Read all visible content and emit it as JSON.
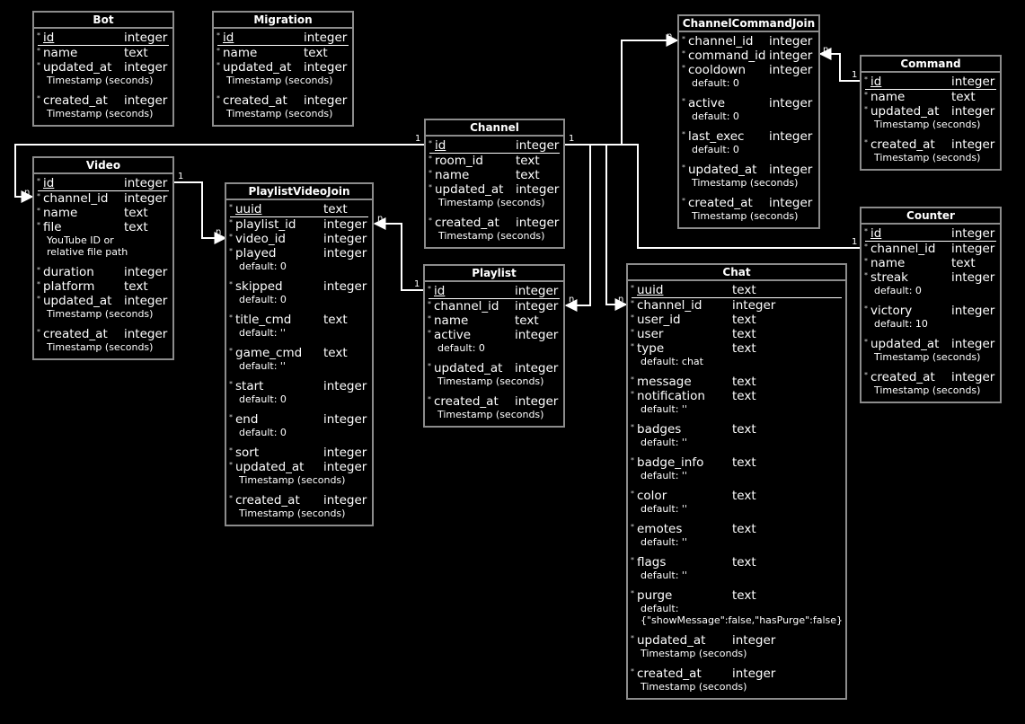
{
  "tables": {
    "Bot": {
      "title": "Bot",
      "fields": [
        {
          "name": "id",
          "type": "integer",
          "pk": true
        },
        {
          "name": "name",
          "type": "text"
        },
        {
          "name": "updated_at",
          "type": "integer",
          "notes": [
            "Timestamp (seconds)"
          ]
        },
        {
          "name": "created_at",
          "type": "integer",
          "notes": [
            "Timestamp (seconds)"
          ]
        }
      ]
    },
    "Migration": {
      "title": "Migration",
      "fields": [
        {
          "name": "id",
          "type": "integer",
          "pk": true
        },
        {
          "name": "name",
          "type": "text"
        },
        {
          "name": "updated_at",
          "type": "integer",
          "notes": [
            "Timestamp (seconds)"
          ]
        },
        {
          "name": "created_at",
          "type": "integer",
          "notes": [
            "Timestamp (seconds)"
          ]
        }
      ]
    },
    "Video": {
      "title": "Video",
      "fields": [
        {
          "name": "id",
          "type": "integer",
          "pk": true
        },
        {
          "name": "channel_id",
          "type": "integer"
        },
        {
          "name": "name",
          "type": "text"
        },
        {
          "name": "file",
          "type": "text",
          "notes": [
            "YouTube ID or",
            "relative file path"
          ]
        },
        {
          "name": "duration",
          "type": "integer"
        },
        {
          "name": "platform",
          "type": "text"
        },
        {
          "name": "updated_at",
          "type": "integer",
          "notes": [
            "Timestamp (seconds)"
          ]
        },
        {
          "name": "created_at",
          "type": "integer",
          "notes": [
            "Timestamp (seconds)"
          ]
        }
      ]
    },
    "PlaylistVideoJoin": {
      "title": "PlaylistVideoJoin",
      "fields": [
        {
          "name": "uuid",
          "type": "text",
          "pk": true
        },
        {
          "name": "playlist_id",
          "type": "integer"
        },
        {
          "name": "video_id",
          "type": "integer"
        },
        {
          "name": "played",
          "type": "integer",
          "notes": [
            "default: 0"
          ]
        },
        {
          "name": "skipped",
          "type": "integer",
          "notes": [
            "default: 0"
          ]
        },
        {
          "name": "title_cmd",
          "type": "text",
          "notes": [
            "default: ''"
          ]
        },
        {
          "name": "game_cmd",
          "type": "text",
          "notes": [
            "default: ''"
          ]
        },
        {
          "name": "start",
          "type": "integer",
          "notes": [
            "default: 0"
          ]
        },
        {
          "name": "end",
          "type": "integer",
          "notes": [
            "default: 0"
          ]
        },
        {
          "name": "sort",
          "type": "integer"
        },
        {
          "name": "updated_at",
          "type": "integer",
          "notes": [
            "Timestamp (seconds)"
          ]
        },
        {
          "name": "created_at",
          "type": "integer",
          "notes": [
            "Timestamp (seconds)"
          ]
        }
      ]
    },
    "Channel": {
      "title": "Channel",
      "fields": [
        {
          "name": "id",
          "type": "integer",
          "pk": true
        },
        {
          "name": "room_id",
          "type": "text"
        },
        {
          "name": "name",
          "type": "text"
        },
        {
          "name": "updated_at",
          "type": "integer",
          "notes": [
            "Timestamp (seconds)"
          ]
        },
        {
          "name": "created_at",
          "type": "integer",
          "notes": [
            "Timestamp (seconds)"
          ]
        }
      ]
    },
    "Playlist": {
      "title": "Playlist",
      "fields": [
        {
          "name": "id",
          "type": "integer",
          "pk": true
        },
        {
          "name": "channel_id",
          "type": "integer"
        },
        {
          "name": "name",
          "type": "text"
        },
        {
          "name": "active",
          "type": "integer",
          "notes": [
            "default: 0"
          ]
        },
        {
          "name": "updated_at",
          "type": "integer",
          "notes": [
            "Timestamp (seconds)"
          ]
        },
        {
          "name": "created_at",
          "type": "integer",
          "notes": [
            "Timestamp (seconds)"
          ]
        }
      ]
    },
    "ChannelCommandJoin": {
      "title": "ChannelCommandJoin",
      "fields": [
        {
          "name": "channel_id",
          "type": "integer"
        },
        {
          "name": "command_id",
          "type": "integer"
        },
        {
          "name": "cooldown",
          "type": "integer",
          "notes": [
            "default: 0"
          ]
        },
        {
          "name": "active",
          "type": "integer",
          "notes": [
            "default: 0"
          ]
        },
        {
          "name": "last_exec",
          "type": "integer",
          "notes": [
            "default: 0"
          ]
        },
        {
          "name": "updated_at",
          "type": "integer",
          "notes": [
            "Timestamp (seconds)"
          ]
        },
        {
          "name": "created_at",
          "type": "integer",
          "notes": [
            "Timestamp (seconds)"
          ]
        }
      ]
    },
    "Command": {
      "title": "Command",
      "fields": [
        {
          "name": "id",
          "type": "integer",
          "pk": true
        },
        {
          "name": "name",
          "type": "text"
        },
        {
          "name": "updated_at",
          "type": "integer",
          "notes": [
            "Timestamp (seconds)"
          ]
        },
        {
          "name": "created_at",
          "type": "integer",
          "notes": [
            "Timestamp (seconds)"
          ]
        }
      ]
    },
    "Counter": {
      "title": "Counter",
      "fields": [
        {
          "name": "id",
          "type": "integer",
          "pk": true
        },
        {
          "name": "channel_id",
          "type": "integer"
        },
        {
          "name": "name",
          "type": "text"
        },
        {
          "name": "streak",
          "type": "integer",
          "notes": [
            "default: 0"
          ]
        },
        {
          "name": "victory",
          "type": "integer",
          "notes": [
            "default: 10"
          ]
        },
        {
          "name": "updated_at",
          "type": "integer",
          "notes": [
            "Timestamp (seconds)"
          ]
        },
        {
          "name": "created_at",
          "type": "integer",
          "notes": [
            "Timestamp (seconds)"
          ]
        }
      ]
    },
    "Chat": {
      "title": "Chat",
      "fields": [
        {
          "name": "uuid",
          "type": "text",
          "pk": true
        },
        {
          "name": "channel_id",
          "type": "integer"
        },
        {
          "name": "user_id",
          "type": "text"
        },
        {
          "name": "user",
          "type": "text"
        },
        {
          "name": "type",
          "type": "text",
          "notes": [
            "default: chat"
          ]
        },
        {
          "name": "message",
          "type": "text"
        },
        {
          "name": "notification",
          "type": "text",
          "notes": [
            "default: ''"
          ]
        },
        {
          "name": "badges",
          "type": "text",
          "notes": [
            "default: ''"
          ]
        },
        {
          "name": "badge_info",
          "type": "text",
          "notes": [
            "default: ''"
          ]
        },
        {
          "name": "color",
          "type": "text",
          "notes": [
            "default: ''"
          ]
        },
        {
          "name": "emotes",
          "type": "text",
          "notes": [
            "default: ''"
          ]
        },
        {
          "name": "flags",
          "type": "text",
          "notes": [
            "default: ''"
          ]
        },
        {
          "name": "purge",
          "type": "text",
          "notes": [
            "default:",
            "{\"showMessage\":false,\"hasPurge\":false}"
          ]
        },
        {
          "name": "updated_at",
          "type": "integer",
          "notes": [
            "Timestamp (seconds)"
          ]
        },
        {
          "name": "created_at",
          "type": "integer",
          "notes": [
            "Timestamp (seconds)"
          ]
        }
      ]
    }
  },
  "relations": [
    {
      "from": "Channel",
      "to": "Video",
      "from_card": "1",
      "to_card": "n"
    },
    {
      "from": "Channel",
      "to": "ChannelCommandJoin",
      "from_card": "1",
      "to_card": "n"
    },
    {
      "from": "Channel",
      "to": "Counter",
      "from_card": "1",
      "to_card": "n"
    },
    {
      "from": "Channel",
      "to": "Playlist",
      "from_card": "1",
      "to_card": "n"
    },
    {
      "from": "Channel",
      "to": "Chat",
      "from_card": "1",
      "to_card": "n"
    },
    {
      "from": "Command",
      "to": "ChannelCommandJoin",
      "from_card": "1",
      "to_card": "n"
    },
    {
      "from": "Video",
      "to": "PlaylistVideoJoin",
      "from_card": "1",
      "to_card": "n"
    },
    {
      "from": "Playlist",
      "to": "PlaylistVideoJoin",
      "from_card": "1",
      "to_card": "n"
    }
  ],
  "colors": {
    "background": "#000000",
    "foreground": "#ffffff",
    "border": "#8c8c8c"
  }
}
